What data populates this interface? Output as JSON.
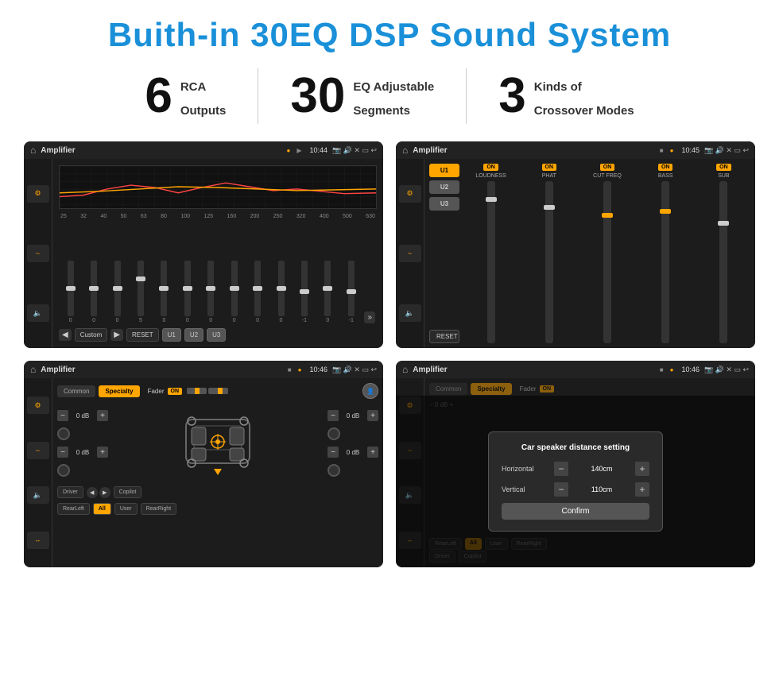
{
  "title": "Buith-in 30EQ DSP Sound System",
  "stats": [
    {
      "number": "6",
      "label1": "RCA",
      "label2": "Outputs"
    },
    {
      "number": "30",
      "label1": "EQ Adjustable",
      "label2": "Segments"
    },
    {
      "number": "3",
      "label1": "Kinds of",
      "label2": "Crossover Modes"
    }
  ],
  "screens": [
    {
      "id": "eq-screen",
      "statusBar": {
        "title": "Amplifier",
        "time": "10:44"
      },
      "freqLabels": [
        "25",
        "32",
        "40",
        "50",
        "63",
        "80",
        "100",
        "125",
        "160",
        "200",
        "250",
        "320",
        "400",
        "500",
        "630"
      ],
      "sliderValues": [
        "0",
        "0",
        "0",
        "5",
        "0",
        "0",
        "0",
        "0",
        "0",
        "0",
        "-1",
        "0",
        "-1"
      ],
      "bottomBtns": [
        "Custom",
        "RESET",
        "U1",
        "U2",
        "U3"
      ]
    },
    {
      "id": "amp-screen",
      "statusBar": {
        "title": "Amplifier",
        "time": "10:45"
      },
      "presets": [
        "U1",
        "U2",
        "U3"
      ],
      "controls": [
        {
          "name": "LOUDNESS",
          "on": true
        },
        {
          "name": "PHAT",
          "on": true
        },
        {
          "name": "CUT FREQ",
          "on": true
        },
        {
          "name": "BASS",
          "on": true
        },
        {
          "name": "SUB",
          "on": true
        }
      ]
    },
    {
      "id": "fader-screen",
      "statusBar": {
        "title": "Amplifier",
        "time": "10:46"
      },
      "tabs": [
        "Common",
        "Specialty"
      ],
      "faderLabel": "Fader",
      "faderOn": "ON",
      "dBValues": [
        "0 dB",
        "0 dB",
        "0 dB",
        "0 dB"
      ],
      "bottomBtns": [
        "Driver",
        "Copilot",
        "RearLeft",
        "All",
        "User",
        "RearRight"
      ]
    },
    {
      "id": "dialog-screen",
      "statusBar": {
        "title": "Amplifier",
        "time": "10:46"
      },
      "tabs": [
        "Common",
        "Specialty"
      ],
      "dialog": {
        "title": "Car speaker distance setting",
        "horizontal": {
          "label": "Horizontal",
          "value": "140cm"
        },
        "vertical": {
          "label": "Vertical",
          "value": "110cm"
        },
        "confirmBtn": "Confirm"
      },
      "dBValues": [
        "0 dB",
        "0 dB"
      ],
      "bottomBtns": [
        "Driver",
        "Copilot",
        "RearLeft",
        "User",
        "RearRight"
      ]
    }
  ]
}
